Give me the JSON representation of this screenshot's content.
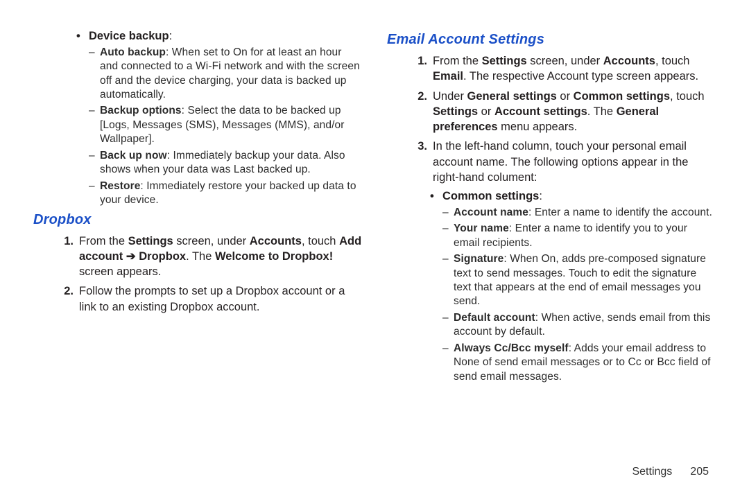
{
  "left": {
    "deviceBackup": {
      "label": "Device backup",
      "auto": {
        "label": "Auto backup",
        "text": ": When set to On for at least an hour and connected to a Wi-Fi network and with the screen off and the device charging, your data is backed up automatically."
      },
      "options": {
        "label": "Backup options",
        "text": ": Select the data to be backed up [Logs, Messages (SMS), Messages (MMS), and/or Wallpaper]."
      },
      "now": {
        "label": "Back up now",
        "text": ": Immediately backup your data. Also shows when your data was Last backed up."
      },
      "restore": {
        "label": "Restore",
        "text": ": Immediately restore your backed up data to your device."
      }
    },
    "dropbox": {
      "heading": "Dropbox",
      "step1": {
        "pre": "From the ",
        "b1": "Settings",
        "mid1": " screen, under ",
        "b2": "Accounts",
        "mid2": ", touch ",
        "b3": "Add account",
        "arrow": " ➔ ",
        "b4": "Dropbox",
        "mid3": ". The ",
        "b5": "Welcome to Dropbox!",
        "post": " screen appears."
      },
      "step2": "Follow the prompts to set up a Dropbox account or a link to an existing Dropbox account."
    }
  },
  "right": {
    "heading": "Email Account Settings",
    "step1": {
      "pre": "From the ",
      "b1": "Settings",
      "mid1": " screen, under ",
      "b2": "Accounts",
      "mid2": ", touch ",
      "b3": "Email",
      "post": ". The respective Account type screen appears."
    },
    "step2": {
      "pre": "Under ",
      "b1": "General settings",
      "mid1": " or ",
      "b2": "Common settings",
      "mid2": ", touch ",
      "b3": "Settings",
      "mid3": " or ",
      "b4": "Account settings",
      "mid4": ". The ",
      "b5": "General preferences",
      "post": " menu appears."
    },
    "step3": "In the left-hand column, touch your personal email account name. The following options appear in the right-hand colument:",
    "common": {
      "label": "Common settings",
      "acct": {
        "label": "Account name",
        "text": ": Enter a name to identify the account."
      },
      "your": {
        "label": "Your name",
        "text": ": Enter a name to identify you to your email recipients."
      },
      "sig": {
        "label": "Signature",
        "text": ": When On, adds pre-composed signature text to send messages. Touch to edit the signature text that appears at the end of email messages you send."
      },
      "def": {
        "label": "Default account",
        "text": ": When active, sends email from this account by default."
      },
      "cc": {
        "label": "Always Cc/Bcc myself",
        "text": ": Adds your email address to None of send email messages or to Cc or Bcc field of send email messages."
      }
    }
  },
  "footer": {
    "section": "Settings",
    "page": "205"
  }
}
